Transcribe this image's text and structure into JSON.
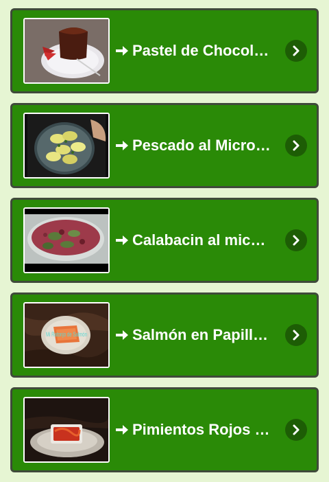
{
  "recipes": [
    {
      "title": "Pastel de Chocolate al microondas",
      "thumbnail": "chocolate-cake-image",
      "action_icon": "chevron-right-icon"
    },
    {
      "title": "Pescado al Microondas",
      "thumbnail": "fish-plate-image",
      "action_icon": "chevron-right-icon"
    },
    {
      "title": "Calabacin al microondas",
      "thumbnail": "zucchini-bowl-image",
      "action_icon": "chevron-right-icon"
    },
    {
      "title": "Salmón en Papillote",
      "thumbnail": "salmon-plate-image",
      "action_icon": "chevron-right-icon",
      "thumb_overlay": "Mi Ratonjo de Salmón"
    },
    {
      "title": "Pimientos Rojos al microondas",
      "thumbnail": "red-peppers-dish-image",
      "action_icon": "chevron-right-icon"
    }
  ],
  "colors": {
    "page_background": "#e6f5d3",
    "card_background": "#2a8a07",
    "card_border": "#3f4a3a",
    "button_background": "#1d5d05",
    "text": "#ffffff"
  }
}
